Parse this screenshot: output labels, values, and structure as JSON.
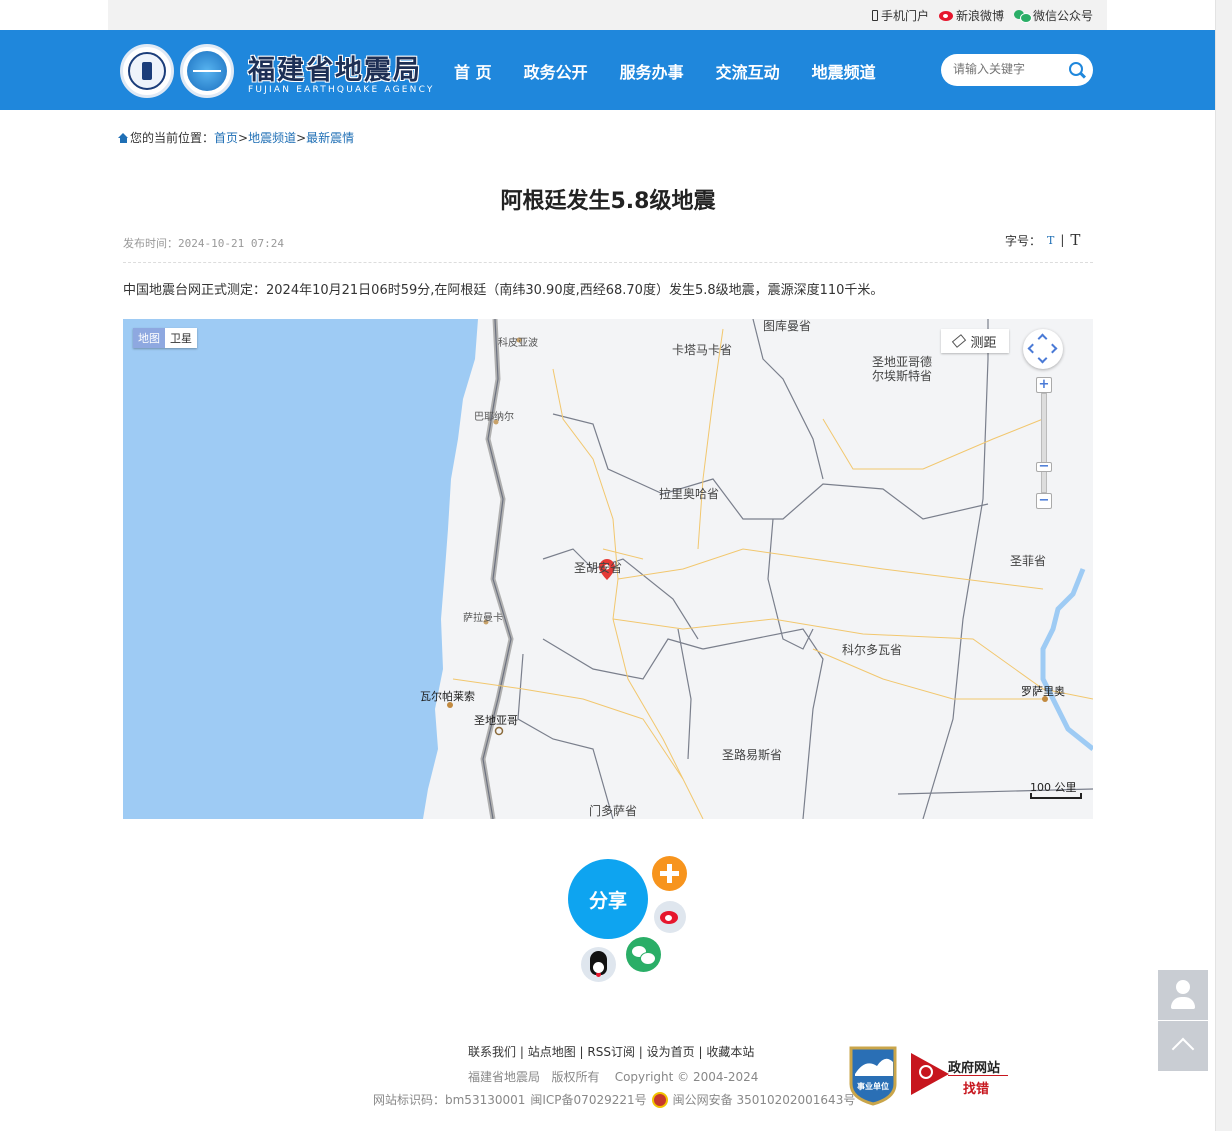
{
  "topbar": {
    "mobile": "手机门户",
    "weibo": "新浪微博",
    "wechat": "微信公众号"
  },
  "header": {
    "logo_cn": "福建省地震局",
    "logo_en": "FUJIAN EARTHQUAKE AGENCY",
    "nav": [
      "首 页",
      "政务公开",
      "服务办事",
      "交流互动",
      "地震频道"
    ],
    "search_placeholder": "请输入关键字",
    "brand_color": "#1f87dc"
  },
  "breadcrumb": {
    "prefix": "您的当前位置：",
    "items": [
      "首页",
      "地震频道",
      "最新震情"
    ],
    "separator": ">"
  },
  "article": {
    "title": "阿根廷发生5.8级地震",
    "publish_label": "发布时间：",
    "publish_time": "2024-10-21 07:24",
    "fontsize_label": "字号：",
    "font_small": "T",
    "font_sep": "|",
    "font_big": "T",
    "body": "中国地震台网正式测定：2024年10月21日06时59分,在阿根廷（南纬30.90度,西经68.70度）发生5.8级地震，震源深度110千米。"
  },
  "map": {
    "type_map": "地图",
    "type_satellite": "卫星",
    "ruler": "测距",
    "scale": "100 公里",
    "labels": {
      "tucuman": "图库曼省",
      "catamarca": "卡塔马卡省",
      "copiapo": "科皮亚波",
      "santiago_estero": "圣地亚哥德尔埃斯特省",
      "vallenar": "巴耶纳尔",
      "la_rioja": "拉里奥哈省",
      "san_juan": "圣胡安省",
      "santa_fe": "圣菲省",
      "salamanca": "萨拉曼卡",
      "cordoba": "科尔多瓦省",
      "valparaiso": "瓦尔帕莱索",
      "rosario": "罗萨里奥",
      "santiago": "圣地亚哥",
      "san_luis": "圣路易斯省",
      "mendoza": "门多萨省"
    }
  },
  "share": {
    "label": "分享"
  },
  "footer": {
    "links": [
      "联系我们",
      "站点地图",
      "RSS订阅",
      "设为首页",
      "收藏本站"
    ],
    "copyright": "福建省地震局   版权所有    Copyright © 2004-2024",
    "site_id": "网站标识码：bm53130001",
    "icp": "闽ICP备07029221号",
    "police": "闽公网安备 35010202001643号",
    "badge": "事业单位",
    "gov_check_1": "政府网站",
    "gov_check_2": "找错"
  }
}
